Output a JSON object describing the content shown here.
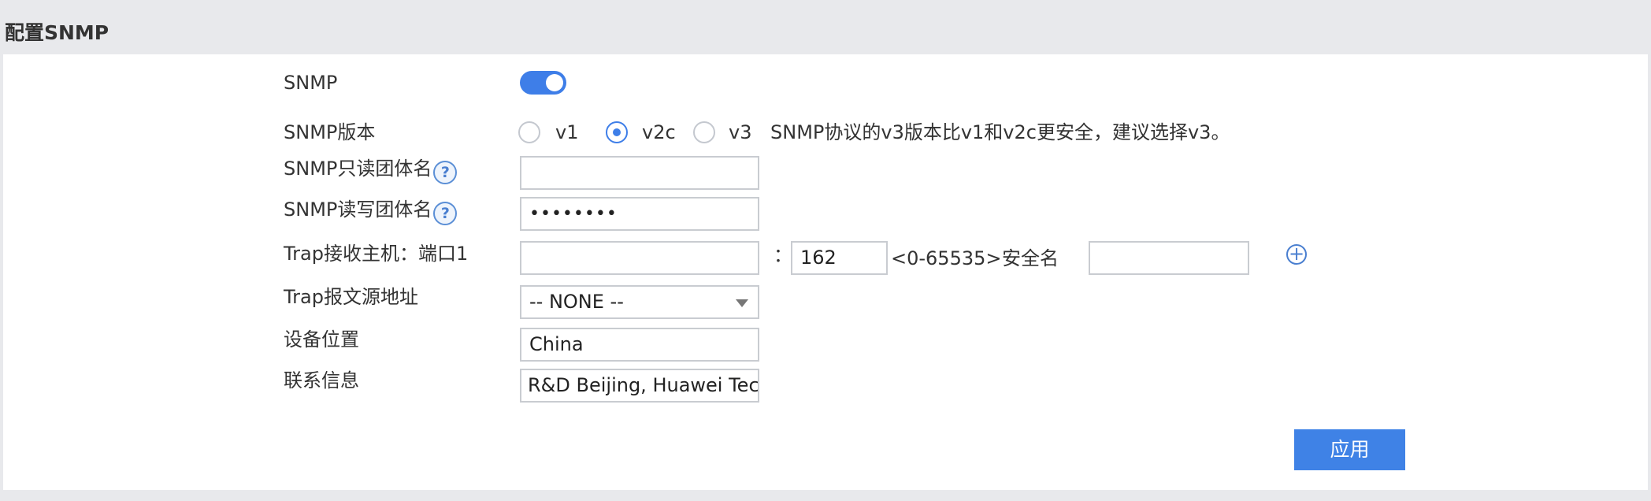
{
  "header": {
    "title": "配置SNMP"
  },
  "form": {
    "snmp": {
      "label": "SNMP",
      "enabled": true
    },
    "version": {
      "label": "SNMP版本",
      "options": [
        "v1",
        "v2c",
        "v3"
      ],
      "selected": "v2c",
      "hint": "SNMP协议的v3版本比v1和v2c更安全，建议选择v3。"
    },
    "ro_community": {
      "label": "SNMP只读团体名",
      "value": ""
    },
    "rw_community": {
      "label": "SNMP读写团体名",
      "value": "••••••••"
    },
    "trap_host": {
      "label": "Trap接收主机：端口1",
      "host_value": "",
      "colon": "：",
      "port_value": "162",
      "port_range": "<0-65535>",
      "security_name_label": "安全名",
      "security_name_value": ""
    },
    "trap_source": {
      "label": "Trap报文源地址",
      "selected": "-- NONE --"
    },
    "location": {
      "label": "设备位置",
      "value": "China"
    },
    "contact": {
      "label": "联系信息",
      "value": "R&D Beijing, Huawei Tech"
    },
    "apply_label": "应用"
  },
  "icons": {
    "help": "question-circle-icon",
    "add": "plus-circle-icon"
  },
  "colors": {
    "accent": "#3e7ee8",
    "apply_button": "#3f82e6",
    "background": "#e8e9ec"
  }
}
